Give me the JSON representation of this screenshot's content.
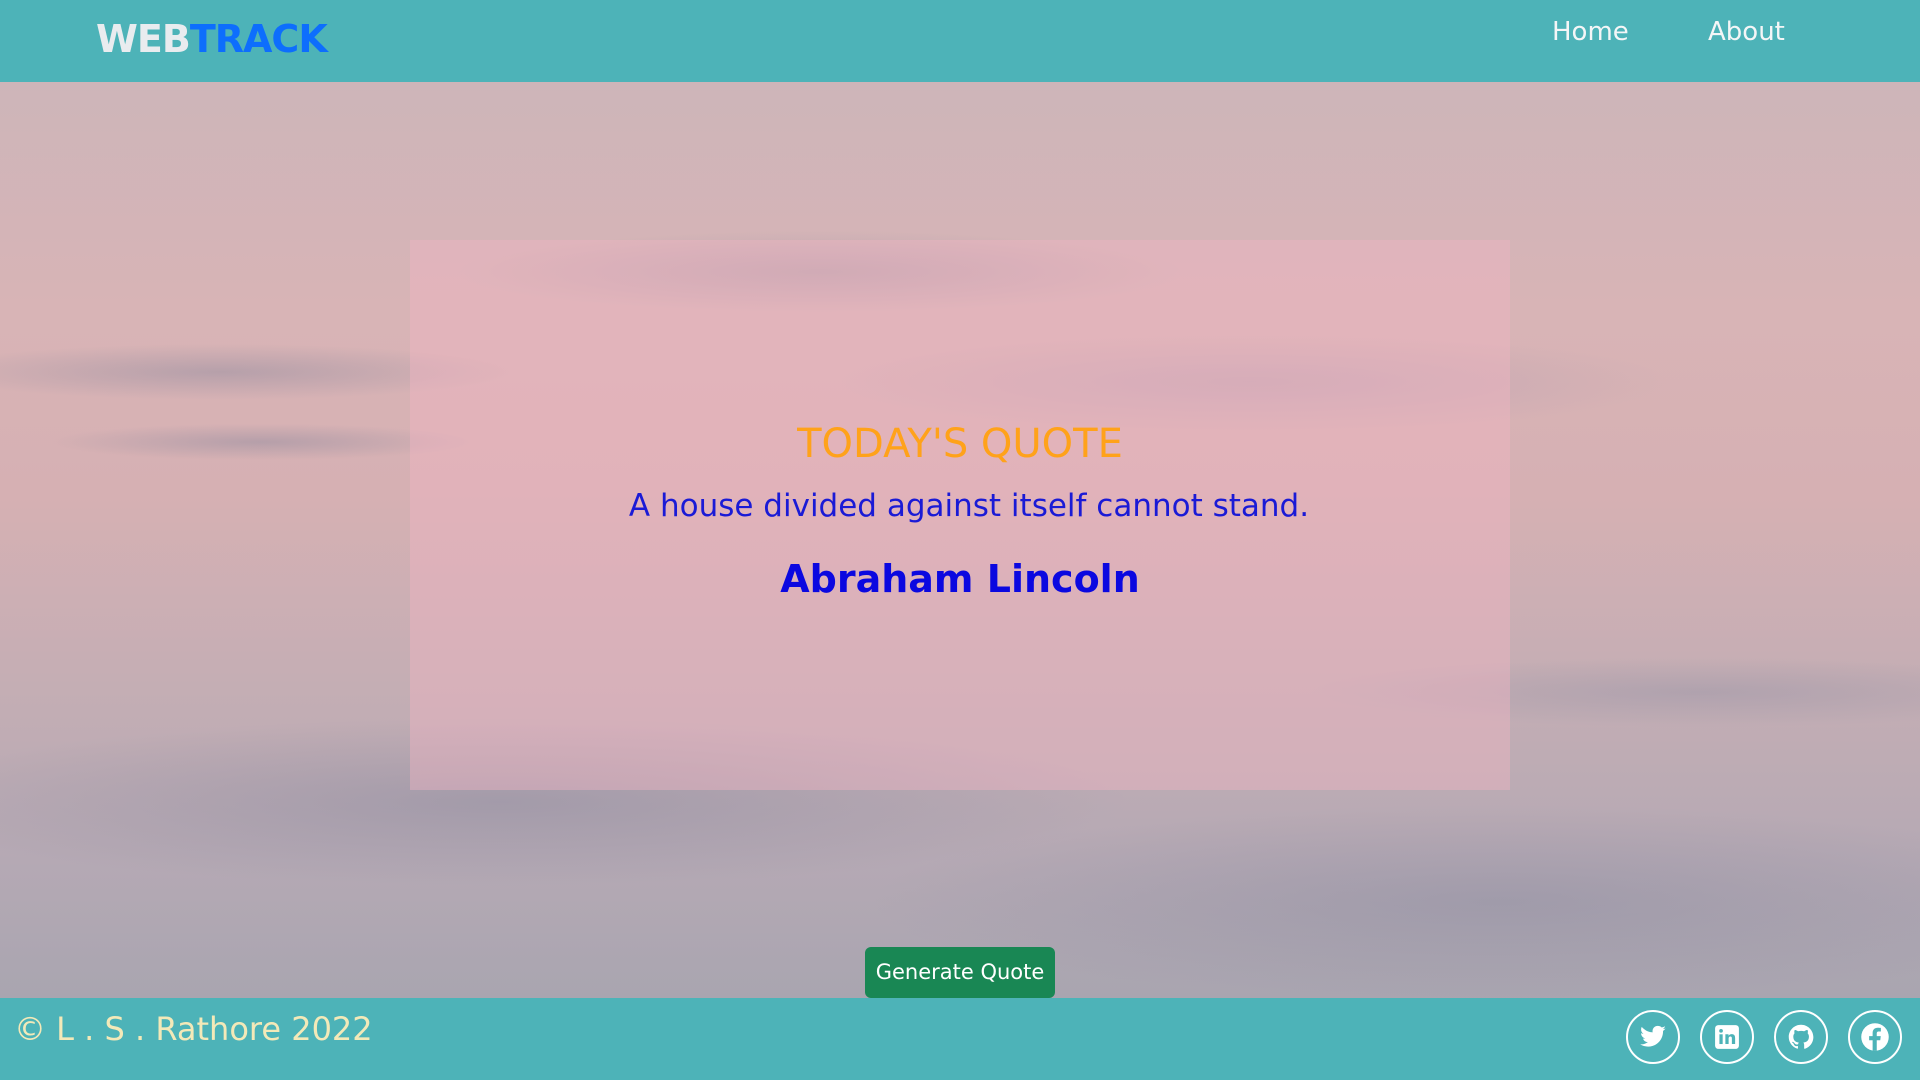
{
  "navbar": {
    "brand_part1": "WEB",
    "brand_part2": "TRACK",
    "links": [
      "Home",
      "About"
    ]
  },
  "quote": {
    "heading": "TODAY'S QUOTE",
    "text": "A house divided against itself cannot stand.",
    "author": "Abraham Lincoln"
  },
  "actions": {
    "generate_label": "Generate Quote"
  },
  "footer": {
    "copyright": "© L . S . Rathore 2022",
    "social_icons": [
      "twitter-icon",
      "linkedin-icon",
      "github-icon",
      "facebook-icon"
    ]
  },
  "colors": {
    "navbar_bg": "#4db3b8",
    "brand_part1": "#e9ecef",
    "brand_part2": "#0d6efd",
    "quote_heading": "#ffa21a",
    "quote_text": "#1a1ad6",
    "quote_author": "#0b08e0",
    "button_bg": "#198754",
    "copyright": "#f3e9b8"
  }
}
